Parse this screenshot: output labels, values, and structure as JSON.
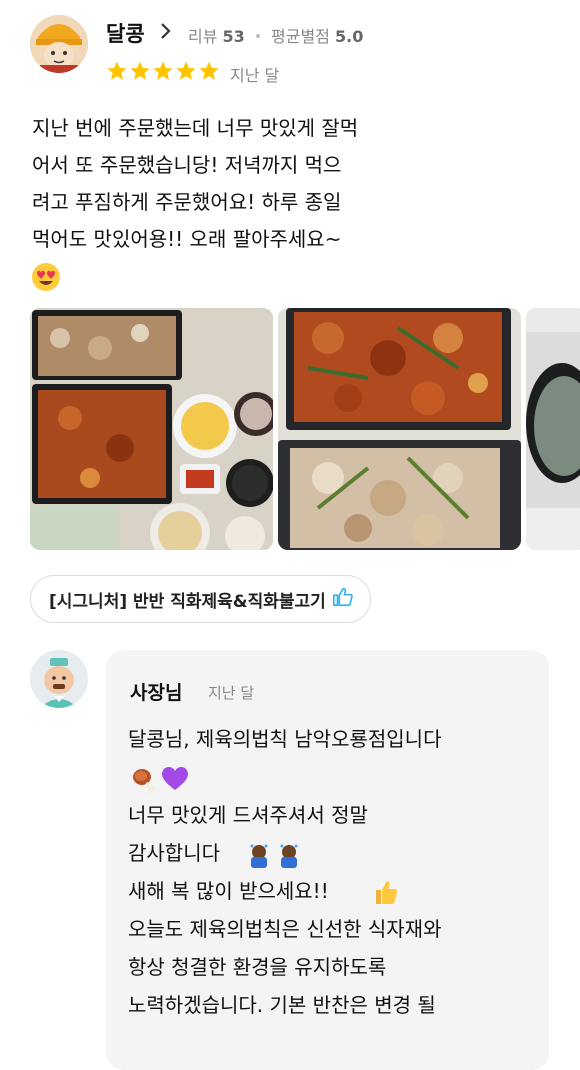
{
  "review": {
    "user_name": "달콩",
    "meta": {
      "review_label": "리뷰",
      "review_count": "53",
      "rating_label": "평균별점",
      "rating_avg": "5.0"
    },
    "stars": 5,
    "date": "지난 달",
    "text": "지난 번에 주문했는데 너무 맛있게 잘먹\n어서 또 주문했습니당! 저녁까지 먹으\n려고 푸짐하게 주문했어요! 하루 종일\n먹어도 맛있어용!! 오래 팔아주세요~",
    "emoji": "heart-eyes"
  },
  "photos": [
    {
      "name": "food-photo-1"
    },
    {
      "name": "food-photo-2"
    },
    {
      "name": "food-photo-3"
    }
  ],
  "menu_tag": {
    "label": "[시그니처] 반반 직화제육&직화불고기",
    "icon": "thumbs-up-icon"
  },
  "owner_reply": {
    "name": "사장님",
    "date": "지난 달",
    "text": "달콩님, 제육의법칙 남악오룡점입니다\n\n너무 맛있게 드셔주셔서 정말\n감사합니다\n새해 복 많이 받으세요!!\n오늘도 제육의법칙은 신선한 식자재와\n항상 청결한 환경을 유지하도록\n노력하겠습니다. 기본 반찬은 변경 될"
  },
  "colors": {
    "star": "#FFC400",
    "thumb": "#2DB4F0",
    "reply_bg": "#F4F4F4"
  }
}
